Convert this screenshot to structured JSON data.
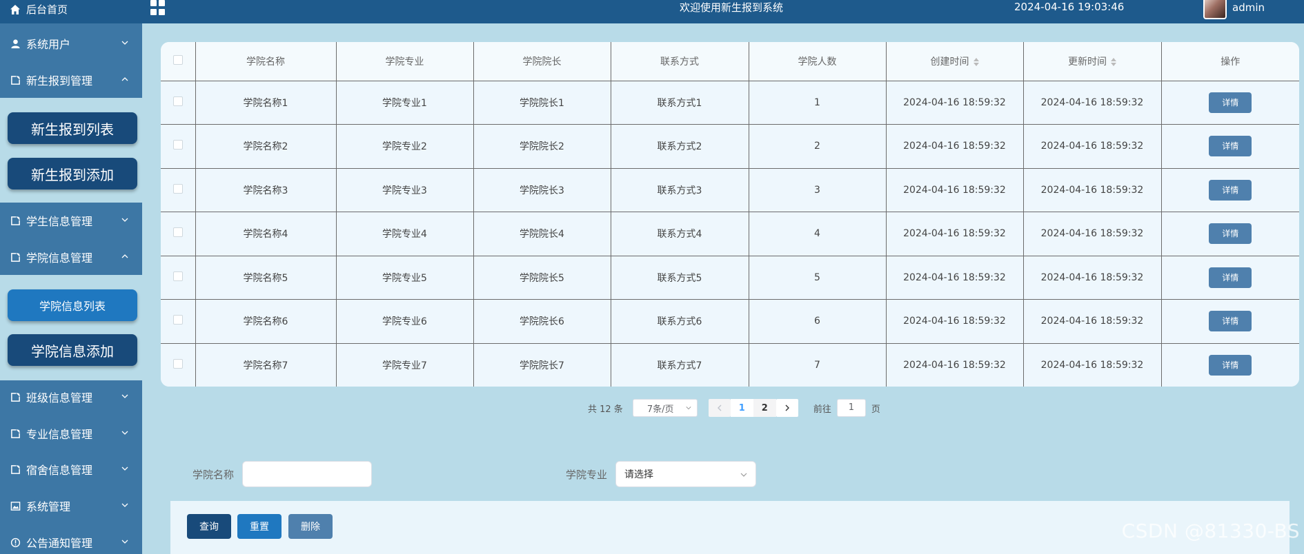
{
  "header": {
    "home_label": "后台首页",
    "title": "欢迎使用新生报到系统",
    "datetime": "2024-04-16 19:03:46",
    "user": "admin"
  },
  "sidebar": {
    "items": [
      {
        "label": "系统用户",
        "icon": "user-icon",
        "expanded": false
      },
      {
        "label": "新生报到管理",
        "icon": "document-icon",
        "expanded": true
      },
      {
        "label": "学生信息管理",
        "icon": "document-icon",
        "expanded": false
      },
      {
        "label": "学院信息管理",
        "icon": "document-icon",
        "expanded": true
      },
      {
        "label": "班级信息管理",
        "icon": "document-icon",
        "expanded": false
      },
      {
        "label": "专业信息管理",
        "icon": "document-icon",
        "expanded": false
      },
      {
        "label": "宿舍信息管理",
        "icon": "document-icon",
        "expanded": false
      },
      {
        "label": "系统管理",
        "icon": "image-icon",
        "expanded": false
      },
      {
        "label": "公告通知管理",
        "icon": "info-icon",
        "expanded": false
      }
    ],
    "sub_registration": [
      "新生报到列表",
      "新生报到添加"
    ],
    "sub_college": [
      "学院信息列表",
      "学院信息添加"
    ]
  },
  "table": {
    "columns": [
      "学院名称",
      "学院专业",
      "学院院长",
      "联系方式",
      "学院人数",
      "创建时间",
      "更新时间",
      "操作"
    ],
    "detail_label": "详情",
    "rows": [
      [
        "学院名称1",
        "学院专业1",
        "学院院长1",
        "联系方式1",
        "1",
        "2024-04-16 18:59:32",
        "2024-04-16 18:59:32"
      ],
      [
        "学院名称2",
        "学院专业2",
        "学院院长2",
        "联系方式2",
        "2",
        "2024-04-16 18:59:32",
        "2024-04-16 18:59:32"
      ],
      [
        "学院名称3",
        "学院专业3",
        "学院院长3",
        "联系方式3",
        "3",
        "2024-04-16 18:59:32",
        "2024-04-16 18:59:32"
      ],
      [
        "学院名称4",
        "学院专业4",
        "学院院长4",
        "联系方式4",
        "4",
        "2024-04-16 18:59:32",
        "2024-04-16 18:59:32"
      ],
      [
        "学院名称5",
        "学院专业5",
        "学院院长5",
        "联系方式5",
        "5",
        "2024-04-16 18:59:32",
        "2024-04-16 18:59:32"
      ],
      [
        "学院名称6",
        "学院专业6",
        "学院院长6",
        "联系方式6",
        "6",
        "2024-04-16 18:59:32",
        "2024-04-16 18:59:32"
      ],
      [
        "学院名称7",
        "学院专业7",
        "学院院长7",
        "联系方式7",
        "7",
        "2024-04-16 18:59:32",
        "2024-04-16 18:59:32"
      ]
    ]
  },
  "pagination": {
    "total": "共 12 条",
    "page_size": "7条/页",
    "pages": [
      "1",
      "2"
    ],
    "current_page": "1",
    "goto_prefix": "前往",
    "goto_value": "1",
    "goto_suffix": "页"
  },
  "search": {
    "name_label": "学院名称",
    "name_value": "",
    "major_label": "学院专业",
    "major_placeholder": "请选择"
  },
  "actions": {
    "query": "查询",
    "reset": "重置",
    "delete": "删除"
  },
  "colors": {
    "header_bg": "#1e5a8c",
    "sidebar_bg": "#3d77a5",
    "submenu_btn": "#184a7a",
    "submenu_active": "#1f78c0",
    "page_bg": "#b8dbe8",
    "query_btn": "#184a7a",
    "reset_btn": "#1f78c0",
    "delete_btn": "#4f80ad"
  },
  "watermark": "CSDN @81330-BS"
}
